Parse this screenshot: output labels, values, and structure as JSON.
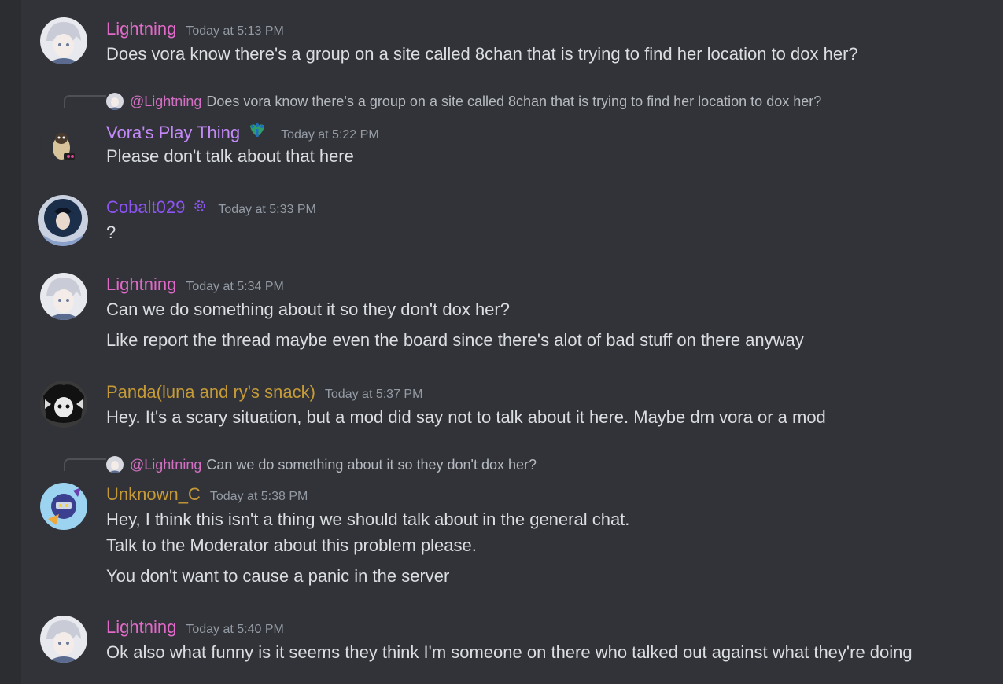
{
  "colors": {
    "lightning": "#e06ac8",
    "vora": "#c58af9",
    "cobalt": "#8c54f5",
    "panda": "#c59a37",
    "unknown": "#c59a37",
    "text": "#dbdee1",
    "timestamp": "#949ba4",
    "new_divider": "#f23f43"
  },
  "messages": [
    {
      "author": "Lightning",
      "timestamp": "Today at 5:13 PM",
      "lines": [
        "Does vora know there's a group on a site called 8chan that is trying to find her location to dox her?"
      ]
    },
    {
      "reply": {
        "mention": "@Lightning",
        "text": "Does vora know there's a group on a site called 8chan that is trying to find her location to dox her?"
      },
      "author": "Vora's Play Thing",
      "badge_icon": "peacock-emoji",
      "timestamp": "Today at 5:22 PM",
      "lines": [
        "Please don't talk about that here"
      ]
    },
    {
      "author": "Cobalt029",
      "badge_icon": "gear-badge-icon",
      "timestamp": "Today at 5:33 PM",
      "lines": [
        "?"
      ]
    },
    {
      "author": "Lightning",
      "timestamp": "Today at 5:34 PM",
      "lines": [
        "Can we do something about it so they don't dox her?",
        "Like report the thread maybe even the board since there's alot of bad stuff on there anyway"
      ]
    },
    {
      "author": "Panda(luna and ry's snack)",
      "timestamp": "Today at 5:37 PM",
      "lines": [
        "Hey. It's a scary situation, but a mod did say not to talk about it here. Maybe dm vora or a mod"
      ]
    },
    {
      "reply": {
        "mention": "@Lightning",
        "text": "Can we do something about it so they don't dox her?"
      },
      "author": "Unknown_C",
      "timestamp": "Today at 5:38 PM",
      "lines": [
        "Hey, I think this isn't a thing we should talk about in the general chat.",
        "Talk to the Moderator about this problem please.",
        "You don't want to cause a panic in the server"
      ]
    },
    {
      "author": "Lightning",
      "timestamp": "Today at 5:40 PM",
      "lines": [
        "Ok also what funny is it seems they think I'm someone on there who talked out against what they're doing"
      ]
    }
  ]
}
